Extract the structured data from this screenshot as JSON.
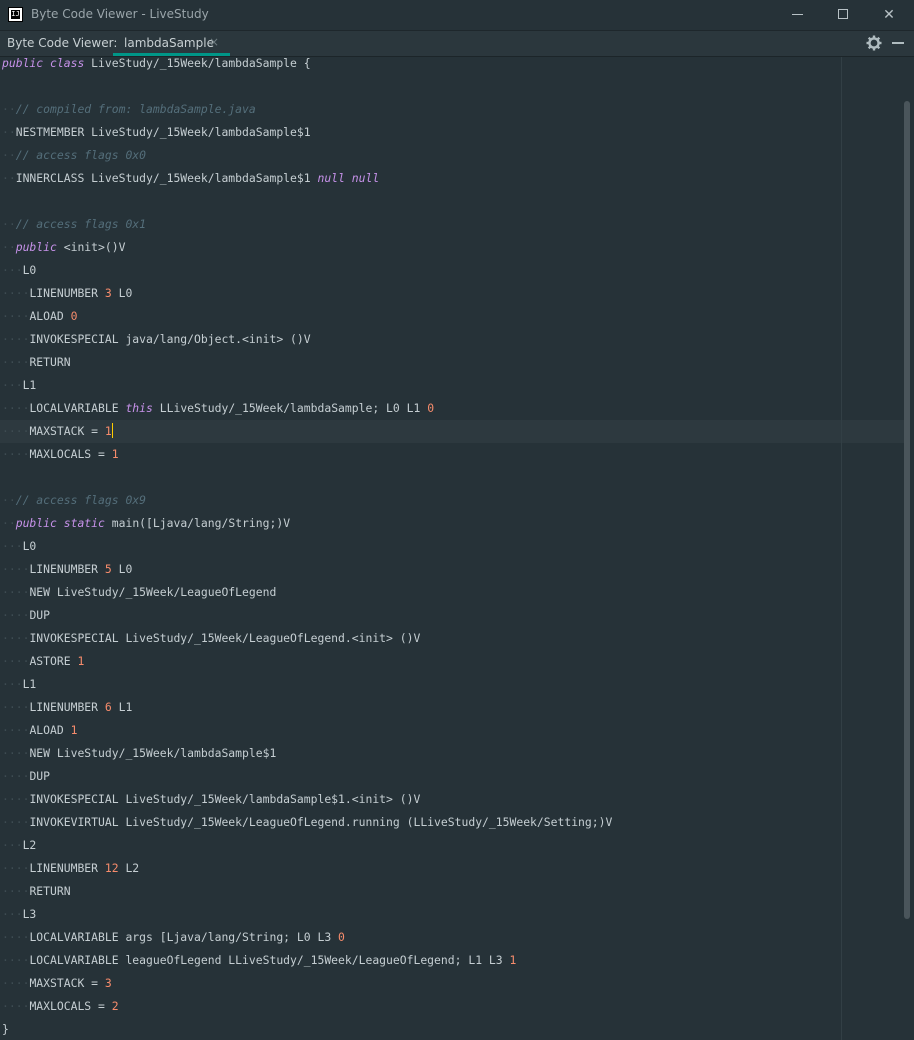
{
  "window": {
    "title": "Byte Code Viewer - LiveStudy",
    "app_icon_text": "IJ",
    "buttons": [
      "minimize",
      "maximize",
      "close"
    ]
  },
  "toolbar": {
    "label": "Byte Code Viewer:",
    "tab": {
      "label": "lambdaSample",
      "close_glyph": "×"
    },
    "icons": [
      "gear-icon",
      "minimize-panel-icon"
    ]
  },
  "colors": {
    "background": "#263238",
    "keyword": "#c792ea",
    "comment": "#546e7a",
    "number": "#f78c6c",
    "text": "#c5ced2",
    "accent": "#009688",
    "caret": "#ffcc00"
  },
  "editor": {
    "caret_line": 17,
    "lines": [
      [
        [
          "kw",
          "public"
        ],
        [
          "t",
          " "
        ],
        [
          "kw",
          "class"
        ],
        [
          "t",
          " LiveStudy/_15Week/lambdaSample {"
        ]
      ],
      [],
      [
        [
          "w",
          "··"
        ],
        [
          "cm",
          "// compiled from: lambdaSample.java"
        ]
      ],
      [
        [
          "w",
          "··"
        ],
        [
          "t",
          "NESTMEMBER LiveStudy/_15Week/lambdaSample$1"
        ]
      ],
      [
        [
          "w",
          "··"
        ],
        [
          "cm",
          "// access flags 0x0"
        ]
      ],
      [
        [
          "w",
          "··"
        ],
        [
          "t",
          "INNERCLASS LiveStudy/_15Week/lambdaSample$1 "
        ],
        [
          "kw",
          "null"
        ],
        [
          "t",
          " "
        ],
        [
          "kw",
          "null"
        ]
      ],
      [],
      [
        [
          "w",
          "··"
        ],
        [
          "cm",
          "// access flags 0x1"
        ]
      ],
      [
        [
          "w",
          "··"
        ],
        [
          "kw",
          "public"
        ],
        [
          "t",
          " <init>()V"
        ]
      ],
      [
        [
          "w",
          "···"
        ],
        [
          "t",
          "L0"
        ]
      ],
      [
        [
          "w",
          "····"
        ],
        [
          "t",
          "LINENUMBER "
        ],
        [
          "nm",
          "3"
        ],
        [
          "t",
          " L0"
        ]
      ],
      [
        [
          "w",
          "····"
        ],
        [
          "t",
          "ALOAD "
        ],
        [
          "nm",
          "0"
        ]
      ],
      [
        [
          "w",
          "····"
        ],
        [
          "t",
          "INVOKESPECIAL java/lang/Object.<init> ()V"
        ]
      ],
      [
        [
          "w",
          "····"
        ],
        [
          "t",
          "RETURN"
        ]
      ],
      [
        [
          "w",
          "···"
        ],
        [
          "t",
          "L1"
        ]
      ],
      [
        [
          "w",
          "····"
        ],
        [
          "t",
          "LOCALVARIABLE "
        ],
        [
          "kw",
          "this"
        ],
        [
          "t",
          " LLiveStudy/_15Week/lambdaSample; L0 L1 "
        ],
        [
          "nm",
          "0"
        ]
      ],
      [
        [
          "w",
          "····"
        ],
        [
          "t",
          "MAXSTACK = "
        ],
        [
          "nm",
          "1"
        ],
        [
          "c",
          ""
        ]
      ],
      [
        [
          "w",
          "····"
        ],
        [
          "t",
          "MAXLOCALS = "
        ],
        [
          "nm",
          "1"
        ]
      ],
      [],
      [
        [
          "w",
          "··"
        ],
        [
          "cm",
          "// access flags 0x9"
        ]
      ],
      [
        [
          "w",
          "··"
        ],
        [
          "kw",
          "public"
        ],
        [
          "t",
          " "
        ],
        [
          "kw",
          "static"
        ],
        [
          "t",
          " main([Ljava/lang/String;)V"
        ]
      ],
      [
        [
          "w",
          "···"
        ],
        [
          "t",
          "L0"
        ]
      ],
      [
        [
          "w",
          "····"
        ],
        [
          "t",
          "LINENUMBER "
        ],
        [
          "nm",
          "5"
        ],
        [
          "t",
          " L0"
        ]
      ],
      [
        [
          "w",
          "····"
        ],
        [
          "t",
          "NEW LiveStudy/_15Week/LeagueOfLegend"
        ]
      ],
      [
        [
          "w",
          "····"
        ],
        [
          "t",
          "DUP"
        ]
      ],
      [
        [
          "w",
          "····"
        ],
        [
          "t",
          "INVOKESPECIAL LiveStudy/_15Week/LeagueOfLegend.<init> ()V"
        ]
      ],
      [
        [
          "w",
          "····"
        ],
        [
          "t",
          "ASTORE "
        ],
        [
          "nm",
          "1"
        ]
      ],
      [
        [
          "w",
          "···"
        ],
        [
          "t",
          "L1"
        ]
      ],
      [
        [
          "w",
          "····"
        ],
        [
          "t",
          "LINENUMBER "
        ],
        [
          "nm",
          "6"
        ],
        [
          "t",
          " L1"
        ]
      ],
      [
        [
          "w",
          "····"
        ],
        [
          "t",
          "ALOAD "
        ],
        [
          "nm",
          "1"
        ]
      ],
      [
        [
          "w",
          "····"
        ],
        [
          "t",
          "NEW LiveStudy/_15Week/lambdaSample$1"
        ]
      ],
      [
        [
          "w",
          "····"
        ],
        [
          "t",
          "DUP"
        ]
      ],
      [
        [
          "w",
          "····"
        ],
        [
          "t",
          "INVOKESPECIAL LiveStudy/_15Week/lambdaSample$1.<init> ()V"
        ]
      ],
      [
        [
          "w",
          "····"
        ],
        [
          "t",
          "INVOKEVIRTUAL LiveStudy/_15Week/LeagueOfLegend.running (LLiveStudy/_15Week/Setting;)V"
        ]
      ],
      [
        [
          "w",
          "···"
        ],
        [
          "t",
          "L2"
        ]
      ],
      [
        [
          "w",
          "····"
        ],
        [
          "t",
          "LINENUMBER "
        ],
        [
          "nm",
          "12"
        ],
        [
          "t",
          " L2"
        ]
      ],
      [
        [
          "w",
          "····"
        ],
        [
          "t",
          "RETURN"
        ]
      ],
      [
        [
          "w",
          "···"
        ],
        [
          "t",
          "L3"
        ]
      ],
      [
        [
          "w",
          "····"
        ],
        [
          "t",
          "LOCALVARIABLE args [Ljava/lang/String; L0 L3 "
        ],
        [
          "nm",
          "0"
        ]
      ],
      [
        [
          "w",
          "····"
        ],
        [
          "t",
          "LOCALVARIABLE leagueOfLegend LLiveStudy/_15Week/LeagueOfLegend; L1 L3 "
        ],
        [
          "nm",
          "1"
        ]
      ],
      [
        [
          "w",
          "····"
        ],
        [
          "t",
          "MAXSTACK = "
        ],
        [
          "nm",
          "3"
        ]
      ],
      [
        [
          "w",
          "····"
        ],
        [
          "t",
          "MAXLOCALS = "
        ],
        [
          "nm",
          "2"
        ]
      ],
      [
        [
          "t",
          "}"
        ]
      ]
    ]
  }
}
